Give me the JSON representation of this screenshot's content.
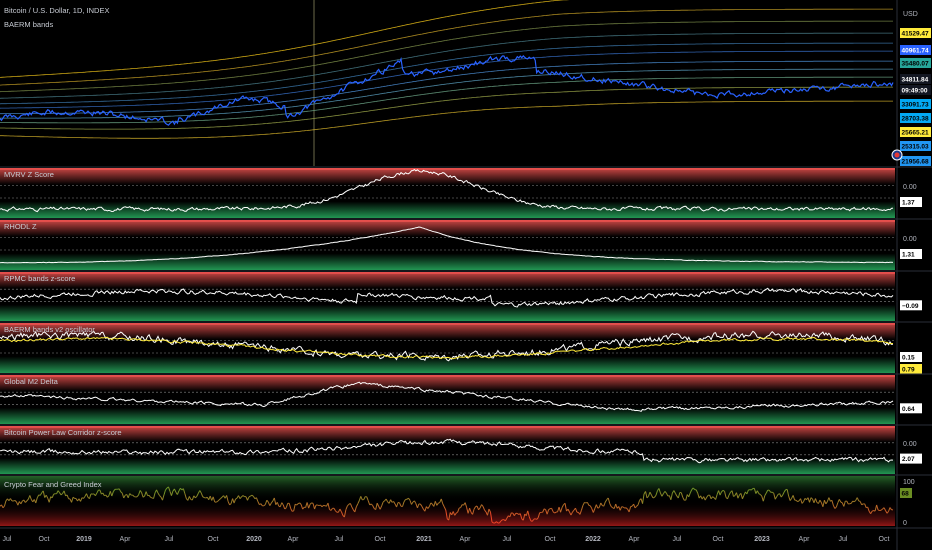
{
  "header": {
    "symbol": "Bitcoin / U.S. Dollar, 1D, INDEX",
    "indicator": "BAERM bands",
    "currency": "USD"
  },
  "chart_data": [
    {
      "type": "line",
      "title": "Bitcoin / U.S. Dollar, 1D, INDEX",
      "series": [
        {
          "name": "BAERM bands",
          "values": [
            21956.68,
            25315.03,
            25665.21,
            28703.38,
            33091.73,
            35480.07,
            40961.74,
            41529.47
          ]
        }
      ],
      "price_labels": [
        {
          "value": "41529.47",
          "color": "#ffeb3b",
          "text_color": "#000000"
        },
        {
          "value": "40961.74",
          "color": "#2962ff",
          "text_color": "#ffffff"
        },
        {
          "value": "35480.07",
          "color": "#26a69a",
          "text_color": "#000000"
        },
        {
          "value": "34811.84",
          "color": "#131722",
          "text_color": "#ffffff"
        },
        {
          "value": "09:49:00",
          "color": "#131722",
          "text_color": "#ffffff"
        },
        {
          "value": "33091.73",
          "color": "#03a9f4",
          "text_color": "#000000"
        },
        {
          "value": "28703.38",
          "color": "#03a9f4",
          "text_color": "#000000"
        },
        {
          "value": "25665.21",
          "color": "#ffeb3b",
          "text_color": "#000000"
        },
        {
          "value": "25315.03",
          "color": "#2196f3",
          "text_color": "#000000"
        },
        {
          "value": "21956.68",
          "color": "#2196f3",
          "text_color": "#000000"
        }
      ]
    },
    {
      "type": "line",
      "title": "MVRV Z Score",
      "zero_label": "0.00",
      "last_value": "1.37"
    },
    {
      "type": "line",
      "title": "RHODL Z",
      "zero_label": "0.00",
      "last_value": "1.31"
    },
    {
      "type": "line",
      "title": "RPMC bands z-score",
      "last_value": "−0.09"
    },
    {
      "type": "line",
      "title": "BAERM bands v2 oscillator",
      "last_value": "0.15",
      "last_value_2": "0.79"
    },
    {
      "type": "line",
      "title": "Global M2 Delta",
      "last_value": "0.64"
    },
    {
      "type": "line",
      "title": "Bitcoin Power Law Corridor z-score",
      "zero_label": "0.00",
      "last_value": "2.07"
    },
    {
      "type": "line",
      "title": "Crypto Fear and Greed Index",
      "axis_labels": [
        "100",
        "0"
      ],
      "last_value": "68"
    }
  ],
  "x_axis": {
    "ticks": [
      "Jul",
      "Oct",
      "2019",
      "Apr",
      "Jul",
      "Oct",
      "2020",
      "Apr",
      "Jul",
      "Oct",
      "2021",
      "Apr",
      "Jul",
      "Oct",
      "2022",
      "Apr",
      "Jul",
      "Oct",
      "2023",
      "Apr",
      "Jul",
      "Oct"
    ]
  },
  "colors": {
    "background": "#000000",
    "price_line": "#2962ff",
    "oscillator_line": "#ffffff",
    "secondary_line": "#ffeb3b",
    "top_band": "#ef5350",
    "bottom_band": "#26a65b",
    "fng_high": "#4caf50",
    "fng_low": "#f44336"
  }
}
